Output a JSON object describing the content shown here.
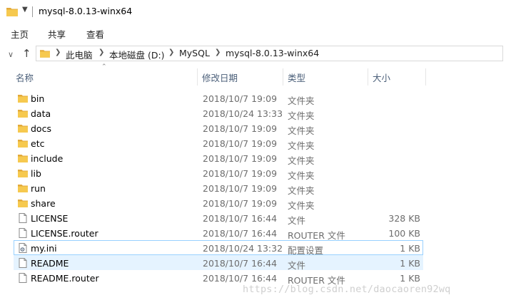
{
  "window": {
    "title": "mysql-8.0.13-winx64"
  },
  "ribbon": {
    "tabs": [
      "主页",
      "共享",
      "查看"
    ]
  },
  "address": {
    "crumbs": [
      "此电脑",
      "本地磁盘 (D:)",
      "MySQL",
      "mysql-8.0.13-winx64"
    ]
  },
  "columns": {
    "name": "名称",
    "date": "修改日期",
    "type": "类型",
    "size": "大小"
  },
  "files": [
    {
      "name": "bin",
      "date": "2018/10/7 19:09",
      "type": "文件夹",
      "size": "",
      "icon": "folder-icon"
    },
    {
      "name": "data",
      "date": "2018/10/24 13:33",
      "type": "文件夹",
      "size": "",
      "icon": "folder-icon"
    },
    {
      "name": "docs",
      "date": "2018/10/7 19:09",
      "type": "文件夹",
      "size": "",
      "icon": "folder-icon"
    },
    {
      "name": "etc",
      "date": "2018/10/7 19:09",
      "type": "文件夹",
      "size": "",
      "icon": "folder-icon"
    },
    {
      "name": "include",
      "date": "2018/10/7 19:09",
      "type": "文件夹",
      "size": "",
      "icon": "folder-icon"
    },
    {
      "name": "lib",
      "date": "2018/10/7 19:09",
      "type": "文件夹",
      "size": "",
      "icon": "folder-icon"
    },
    {
      "name": "run",
      "date": "2018/10/7 19:09",
      "type": "文件夹",
      "size": "",
      "icon": "folder-icon"
    },
    {
      "name": "share",
      "date": "2018/10/7 19:09",
      "type": "文件夹",
      "size": "",
      "icon": "folder-icon"
    },
    {
      "name": "LICENSE",
      "date": "2018/10/7 16:44",
      "type": "文件",
      "size": "328 KB",
      "icon": "file-icon"
    },
    {
      "name": "LICENSE.router",
      "date": "2018/10/7 16:44",
      "type": "ROUTER 文件",
      "size": "100 KB",
      "icon": "file-icon"
    },
    {
      "name": "my.ini",
      "date": "2018/10/24 13:32",
      "type": "配置设置",
      "size": "1 KB",
      "icon": "settings-file-icon"
    },
    {
      "name": "README",
      "date": "2018/10/7 16:44",
      "type": "文件",
      "size": "1 KB",
      "icon": "file-icon"
    },
    {
      "name": "README.router",
      "date": "2018/10/7 16:44",
      "type": "ROUTER 文件",
      "size": "1 KB",
      "icon": "file-icon"
    }
  ],
  "watermark": "https://blog.csdn.net/daocaoren92wq",
  "colors": {
    "folder": "#f6c94f",
    "folder_dark": "#e2a93a",
    "hover_border": "#99d1ff",
    "selected_bg": "#e5f3ff",
    "header_text": "#4c607a"
  }
}
